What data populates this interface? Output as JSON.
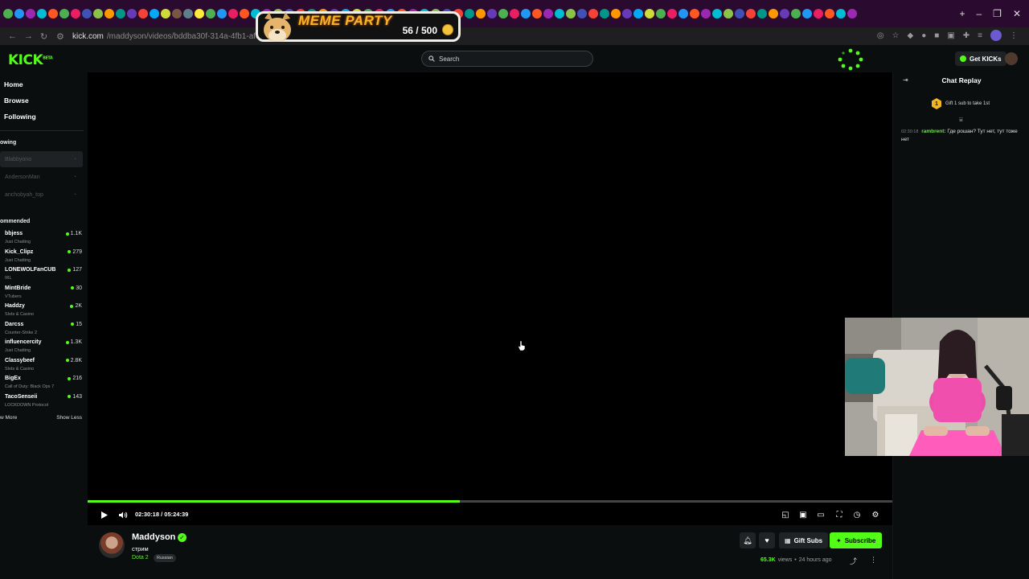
{
  "browser": {
    "url_host": "kick.com",
    "url_path": "/maddyson/videos/bddba30f-314a-4fb1-af8f-77502a487865",
    "tab_colors": [
      "#4caf50",
      "#2196f3",
      "#9c27b0",
      "#00bcd4",
      "#ff5722",
      "#4caf50",
      "#e91e63",
      "#3f51b5",
      "#8bc34a",
      "#ff9800",
      "#009688",
      "#673ab7",
      "#f44336",
      "#03a9f4",
      "#cddc39",
      "#795548",
      "#607d8b",
      "#ffeb3b",
      "#4caf50",
      "#2196f3",
      "#e91e63",
      "#ff5722",
      "#00bcd4",
      "#9c27b0",
      "#8bc34a",
      "#3f51b5",
      "#f44336",
      "#009688",
      "#ff9800",
      "#673ab7",
      "#03a9f4",
      "#cddc39",
      "#4caf50",
      "#e91e63",
      "#2196f3",
      "#ff5722",
      "#9c27b0",
      "#00bcd4",
      "#8bc34a",
      "#3f51b5",
      "#f44336",
      "#009688",
      "#ff9800",
      "#673ab7",
      "#4caf50",
      "#e91e63",
      "#2196f3",
      "#ff5722",
      "#9c27b0",
      "#00bcd4",
      "#8bc34a",
      "#3f51b5",
      "#f44336",
      "#009688",
      "#ff9800",
      "#673ab7",
      "#03a9f4",
      "#cddc39",
      "#4caf50",
      "#e91e63",
      "#2196f3",
      "#ff5722",
      "#9c27b0",
      "#00bcd4",
      "#8bc34a",
      "#3f51b5",
      "#f44336",
      "#009688",
      "#ff9800",
      "#673ab7",
      "#4caf50",
      "#2196f3",
      "#e91e63",
      "#ff5722",
      "#00bcd4",
      "#9c27b0"
    ],
    "new_tab": "+",
    "minimize": "–",
    "maximize": "❐",
    "close": "✕"
  },
  "meme_party": {
    "title": "MEME PARTY",
    "count": "56 / 500"
  },
  "header": {
    "logo": "KICK",
    "logo_mark": "BETA",
    "search_placeholder": "Search",
    "get_kicks": "Get KICKs"
  },
  "sidebar": {
    "nav": [
      "Home",
      "Browse",
      "Following"
    ],
    "following_heading": "owing",
    "following": [
      {
        "name": "Blabbyono",
        "highlight": true
      },
      {
        "name": "AndersonMan",
        "highlight": false
      },
      {
        "name": "anchobyah_top",
        "highlight": false
      }
    ],
    "recommended_heading": "ommended",
    "recommended": [
      {
        "name": "bbjess",
        "category": "Just Chatting",
        "viewers": "1.1K"
      },
      {
        "name": "Kick_Clipz",
        "category": "Just Chatting",
        "viewers": "279"
      },
      {
        "name": "LONEWOLFanCUB",
        "category": "IRL",
        "viewers": "127"
      },
      {
        "name": "MintBride",
        "category": "VTubers",
        "viewers": "30"
      },
      {
        "name": "Haddzy",
        "category": "Slots & Casino",
        "viewers": "2K"
      },
      {
        "name": "Darcss",
        "category": "Counter-Strike 2",
        "viewers": "15"
      },
      {
        "name": "influencercity",
        "category": "Just Chatting",
        "viewers": "1.3K"
      },
      {
        "name": "Classybeef",
        "category": "Slots & Casino",
        "viewers": "2.8K"
      },
      {
        "name": "BigEx",
        "category": "Call of Duty: Black Ops 7",
        "viewers": "216"
      },
      {
        "name": "TacoSenseii",
        "category": "LOCKDOWN Protocol",
        "viewers": "143"
      }
    ],
    "show_more": "w More",
    "show_less": "Show Less"
  },
  "player": {
    "progress": 0.4627,
    "timecode": "02:30:18 / 05:24:39"
  },
  "streamer": {
    "name": "Maddyson",
    "title": "стрим",
    "category": "Dota 2",
    "tag": "Russian",
    "gift_subs": "Gift Subs",
    "subscribe": "Subscribe",
    "views_count": "65.3K",
    "views_label": "views",
    "separator": "•",
    "ago": "24 hours ago"
  },
  "chat": {
    "title": "Chat Replay",
    "gift_rank": "1",
    "gift_text": "Gift 1 sub to take 1st",
    "message": {
      "time": "02:30:18",
      "user": "rambrent:",
      "text": "Где рошан? Тут нет, тут тоже нет"
    }
  }
}
